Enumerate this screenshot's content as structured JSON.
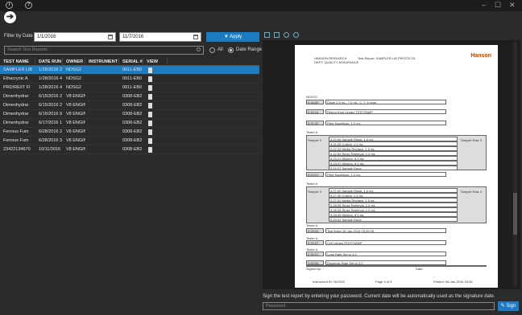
{
  "toolbar": {
    "info_icon": "i",
    "help_icon": "?",
    "win_min": "–",
    "win_max": "☐",
    "win_close": "✕",
    "back_icon": "➔"
  },
  "filter": {
    "label": "Filter by Date",
    "start_date": "1/1/2016",
    "end_date": "11/7/2016",
    "apply_label": "▼ Apply",
    "search_placeholder": "Search Test Reports",
    "radio_all": "All",
    "radio_range": "Date Range"
  },
  "table": {
    "headers": [
      "TEST NAME",
      "DATE RUN",
      "OWNER",
      "INSTRUMENT",
      "SERIAL #",
      "VIEW"
    ],
    "rows": [
      [
        "SAMPLER LIB",
        "1/28/2016 2",
        "NDSG2",
        "",
        "0911-EB0",
        ""
      ],
      [
        "Ethacrynic A",
        "1/28/2016 4",
        "NDSG2",
        "",
        "0911-EB0",
        ""
      ],
      [
        "PRD/RE/IT FI",
        "1/28/2016 4",
        "NDSG2",
        "",
        "0911-EB0",
        ""
      ],
      [
        "Dimenhydrar",
        "6/15/2016 2",
        "V8 ENGINEERI",
        "",
        "0308-EB2",
        ""
      ],
      [
        "Dimenhydrar",
        "6/15/2016 2",
        "V8 ENGINEERI",
        "",
        "0308-EB2",
        ""
      ],
      [
        "Dimenhydrar",
        "6/16/2016 9",
        "V8 ENGINEERI",
        "",
        "0308-EB2",
        ""
      ],
      [
        "Dimenhydrar",
        "6/17/2016 1",
        "V8 ENGINEERI",
        "",
        "0308-EB2",
        ""
      ],
      [
        "Ferrous Fum",
        "6/28/2016 2",
        "V8 ENGINEERI",
        "",
        "0308-EB2",
        ""
      ],
      [
        "Ferrous Fum",
        "6/28/2016 3",
        "V8 ENGINEERI",
        "",
        "0308-EB2",
        ""
      ],
      [
        "23422134670",
        "10/11/2016",
        "V8 ENGINEERI",
        "",
        "0308-EB2",
        ""
      ]
    ]
  },
  "report": {
    "company": "HANSON RESEARCH",
    "dept": "DEPT: QUALITY ASSURANCE",
    "title": "Test Report: SAMPLER LIB PROTOCOL",
    "logo": "Hanson",
    "header_ndsg": "NDSG2",
    "lines": [
      [
        "0:16:00",
        "Dilute 2.5 mL, 7.0 mL, C, T, 6 rows"
      ],
      [
        "0:16:14",
        "Return from Library TESTSAMP"
      ],
      [
        "0:21:32",
        "Filter Backflush, 1.0 mL"
      ],
      [
        "0:24:01",
        "Filter Backflush, 1.0 mL"
      ],
      [
        "0:29:04",
        "Test finish 28-Jan-2016 15:26:05"
      ],
      [
        "0:29:07",
        "Cell Library POSTSAMP"
      ],
      [
        "0:30:01",
        "Load Rate Set to 3.0"
      ],
      [
        "0:30:06",
        "Dispense Rate Set to 3.0"
      ]
    ],
    "tester": "Tester A",
    "sample3": "Sample 3",
    "sample4": "Sample 4",
    "raw3": "Sample Raw 3",
    "raw4": "Sample Raw 4",
    "grid_a": [
      "0:22:00 Sample Rinse, 1.0 mL",
      "0:22:26 Collect, 1.0 mL",
      "0:22:33 Media Replace, 1.0 mL",
      "0:22:54 Rinse Retrieval, 1.0 mL",
      "0:23:21 Dilution, 5.0 mL",
      "0:23:47 Dilution, 5.0 mL",
      "0:24:01 Sample Done"
    ],
    "grid_b": [
      "0:27:00 Sample Rinse, 1.0 mL",
      "0:27:30 Collect, 1.0 mL",
      "0:27:51 Media Replace, 1.0 mL",
      "0:28:05 Rinse Retrieval, 1.0 mL",
      "0:28:26 Rinse Retrieval, 1.0 mL",
      "0:28:45 Dilution, 5.0 mL",
      "0:29:02 Sample Done"
    ],
    "signed_by": "Signed by:",
    "date_label": "Date:",
    "instrument_id": "Instrument ID: NDSG2",
    "page_of": "Page 4 of 5",
    "printed": "Printed: 08-Jan-2016 16:36"
  },
  "sign": {
    "prompt": "Sign the test report by entering your password. Current date will be automatically used as the signature date.",
    "password_placeholder": "Password",
    "sign_label": "✎ Sign"
  }
}
